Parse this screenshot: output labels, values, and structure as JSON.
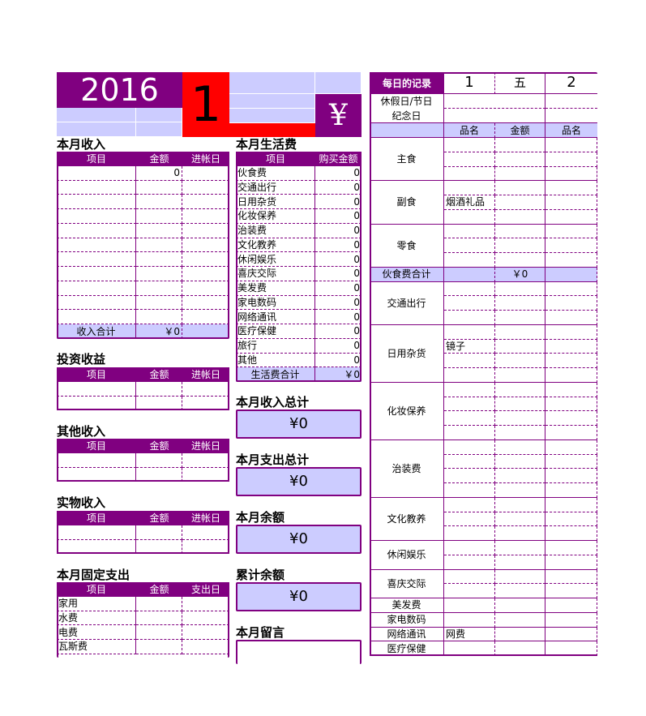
{
  "colors": {
    "accent": "#800080",
    "lavender": "#ccccff",
    "red": "#ff0000"
  },
  "header": {
    "year": "2016",
    "month": "1",
    "currency_icon": "¥"
  },
  "income": {
    "title": "本月收入",
    "columns": [
      "项目",
      "金额",
      "进帐日"
    ],
    "rows": [
      [
        "",
        "0",
        ""
      ],
      [
        "",
        "",
        ""
      ],
      [
        "",
        "",
        ""
      ],
      [
        "",
        "",
        ""
      ],
      [
        "",
        "",
        ""
      ],
      [
        "",
        "",
        ""
      ],
      [
        "",
        "",
        ""
      ],
      [
        "",
        "",
        ""
      ],
      [
        "",
        "",
        ""
      ],
      [
        "",
        "",
        ""
      ],
      [
        "",
        "",
        ""
      ]
    ],
    "total_label": "收入合计",
    "total_value": "￥0"
  },
  "investment": {
    "title": "投资收益",
    "columns": [
      "项目",
      "金额",
      "进帐日"
    ],
    "rows": [
      [
        "",
        "",
        ""
      ],
      [
        "",
        "",
        ""
      ]
    ]
  },
  "other_income": {
    "title": "其他收入",
    "columns": [
      "项目",
      "金额",
      "进帐日"
    ],
    "rows": [
      [
        "",
        "",
        ""
      ],
      [
        "",
        "",
        ""
      ]
    ]
  },
  "in_kind_income": {
    "title": "实物收入",
    "columns": [
      "项目",
      "金额",
      "进帐日"
    ],
    "rows": [
      [
        "",
        "",
        ""
      ],
      [
        "",
        "",
        ""
      ]
    ]
  },
  "fixed_expense": {
    "title": "本月固定支出",
    "columns": [
      "项目",
      "金额",
      "支出日"
    ],
    "rows": [
      [
        "家用",
        "",
        ""
      ],
      [
        "水费",
        "",
        ""
      ],
      [
        "电费",
        "",
        ""
      ],
      [
        "瓦斯费",
        "",
        ""
      ]
    ]
  },
  "living": {
    "title": "本月生活费",
    "columns": [
      "项目",
      "购买金额"
    ],
    "rows": [
      [
        "伙食费",
        "0"
      ],
      [
        "交通出行",
        "0"
      ],
      [
        "日用杂货",
        "0"
      ],
      [
        "化妆保养",
        "0"
      ],
      [
        "治装费",
        "0"
      ],
      [
        "文化教养",
        "0"
      ],
      [
        "休闲娱乐",
        "0"
      ],
      [
        "喜庆交际",
        "0"
      ],
      [
        "美发费",
        "0"
      ],
      [
        "家电数码",
        "0"
      ],
      [
        "网络通讯",
        "0"
      ],
      [
        "医疗保健",
        "0"
      ],
      [
        "旅行",
        "0"
      ],
      [
        "其他",
        "0"
      ]
    ],
    "total_label": "生活费合计",
    "total_value": "￥0"
  },
  "summary": [
    {
      "title": "本月收入总计",
      "value": "¥0"
    },
    {
      "title": "本月支出总计",
      "value": "¥0"
    },
    {
      "title": "本月余额",
      "value": "¥0"
    },
    {
      "title": "累计余额",
      "value": "¥0"
    },
    {
      "title": "本月留言",
      "value": ""
    }
  ],
  "daily": {
    "title": "每日的记录",
    "day1": "1",
    "weekday1": "五",
    "day2": "2",
    "holiday_label": "休假日/节日",
    "anniversary_label": "纪念日",
    "col_headers": [
      "品名",
      "金额",
      "品名"
    ],
    "sections": [
      {
        "label": "主食",
        "rows": [
          [
            "",
            "",
            ""
          ],
          [
            "",
            "",
            ""
          ],
          [
            "",
            "",
            ""
          ]
        ]
      },
      {
        "label": "副食",
        "rows": [
          [
            "",
            "",
            ""
          ],
          [
            "烟酒礼品",
            "",
            ""
          ],
          [
            "",
            "",
            ""
          ]
        ]
      },
      {
        "label": "零食",
        "rows": [
          [
            "",
            "",
            ""
          ],
          [
            "",
            "",
            ""
          ],
          [
            "",
            "",
            ""
          ]
        ]
      },
      {
        "label": "伙食费合计",
        "total": true,
        "rows": [
          [
            "",
            "￥0",
            ""
          ]
        ]
      },
      {
        "label": "交通出行",
        "rows": [
          [
            "",
            "",
            ""
          ],
          [
            "",
            "",
            ""
          ],
          [
            "",
            "",
            ""
          ]
        ]
      },
      {
        "label": "日用杂货",
        "rows": [
          [
            "",
            "",
            ""
          ],
          [
            "镜子",
            "",
            ""
          ],
          [
            "",
            "",
            ""
          ],
          [
            "",
            "",
            ""
          ]
        ]
      },
      {
        "label": "化妆保养",
        "rows": [
          [
            "",
            "",
            ""
          ],
          [
            "",
            "",
            ""
          ],
          [
            "",
            "",
            ""
          ],
          [
            "",
            "",
            ""
          ]
        ]
      },
      {
        "label": "治装费",
        "rows": [
          [
            "",
            "",
            ""
          ],
          [
            "",
            "",
            ""
          ],
          [
            "",
            "",
            ""
          ],
          [
            "",
            "",
            ""
          ]
        ]
      },
      {
        "label": "文化教养",
        "rows": [
          [
            "",
            "",
            ""
          ],
          [
            "",
            "",
            ""
          ],
          [
            "",
            "",
            ""
          ]
        ]
      },
      {
        "label": "休闲娱乐",
        "rows": [
          [
            "",
            "",
            ""
          ],
          [
            "",
            "",
            ""
          ]
        ]
      },
      {
        "label": "喜庆交际",
        "rows": [
          [
            "",
            "",
            ""
          ],
          [
            "",
            "",
            ""
          ]
        ]
      },
      {
        "label": "美发费",
        "rows": [
          [
            "",
            "",
            ""
          ]
        ]
      },
      {
        "label": "家电数码",
        "rows": [
          [
            "",
            "",
            ""
          ]
        ]
      },
      {
        "label": "网络通讯",
        "rows": [
          [
            "网费",
            "",
            ""
          ]
        ]
      },
      {
        "label": "医疗保健",
        "rows": [
          [
            "",
            "",
            ""
          ]
        ]
      }
    ]
  }
}
